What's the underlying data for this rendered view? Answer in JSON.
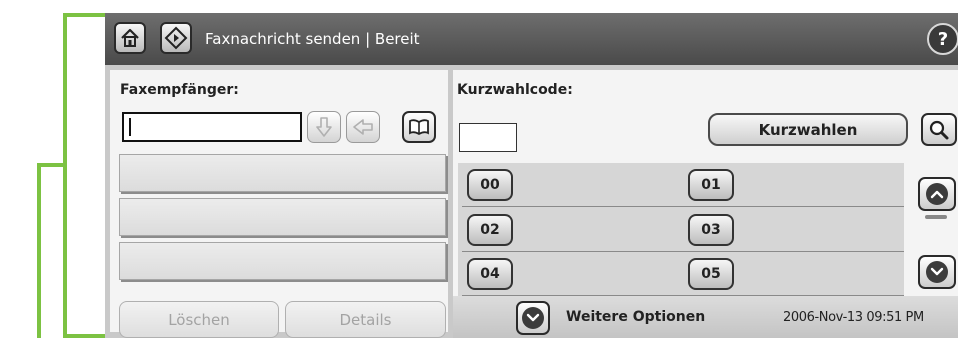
{
  "titlebar": {
    "title": "Faxnachricht senden | Bereit",
    "home_icon": "home-icon",
    "start_icon": "diamond-start-icon",
    "help_label": "?"
  },
  "fax": {
    "label": "Faxempfänger:",
    "input_value": "",
    "buttons": [
      "arrow-down-icon",
      "arrow-left-icon",
      "address-book-icon"
    ],
    "recipients": [
      "",
      "",
      ""
    ],
    "delete_label": "Löschen",
    "details_label": "Details"
  },
  "speed_dial": {
    "label": "Kurzwahlcode:",
    "code_value": "",
    "kurzwahlen_label": "Kurzwahlen",
    "search_icon": "magnifier-icon",
    "codes": [
      "00",
      "01",
      "02",
      "03",
      "04",
      "05"
    ],
    "scroll_up_icon": "scroll-up-icon",
    "scroll_down_icon": "scroll-down-icon"
  },
  "status": {
    "more_options_label": "Weitere Optionen",
    "datetime": "2006-Nov-13  09:51 PM"
  },
  "colors": {
    "accent_callout": "#7cc242",
    "titlebar_bg": "#4a4a4a",
    "panel_bg": "#f4f4f4"
  }
}
